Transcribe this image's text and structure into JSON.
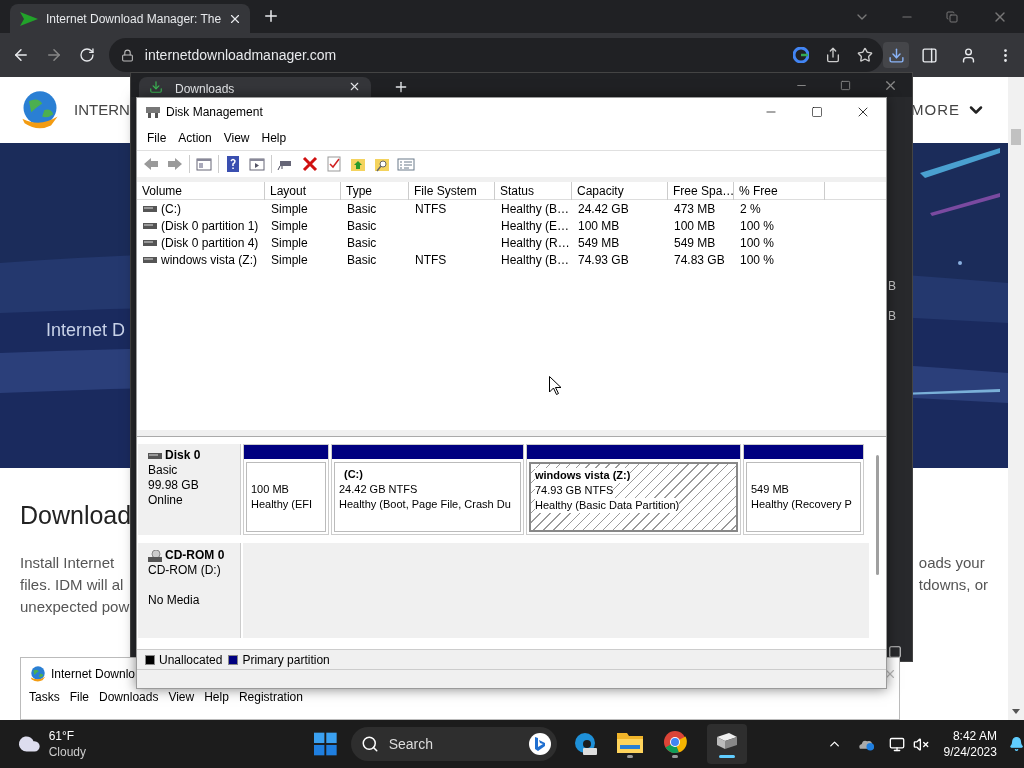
{
  "browser": {
    "tab_title": "Internet Download Manager: The",
    "url": "internetdownloadmanager.com"
  },
  "web_page": {
    "brand": "INTERN",
    "menu": "MORE",
    "hero_text": "Internet D",
    "heading": "Download",
    "paragraph_left": [
      "Install Internet",
      "files. IDM will al",
      "unexpected pow"
    ],
    "paragraph_right": [
      "oads your",
      "tdowns, or"
    ]
  },
  "downloads_window": {
    "title": "Downloads",
    "sizes": [
      "B",
      "B"
    ]
  },
  "idm_window": {
    "title": "Internet Downlo",
    "menu": [
      "Tasks",
      "File",
      "Downloads",
      "View",
      "Help",
      "Registration"
    ]
  },
  "disk_management": {
    "title": "Disk Management",
    "menu": [
      "File",
      "Action",
      "View",
      "Help"
    ],
    "table": {
      "columns": [
        "Volume",
        "Layout",
        "Type",
        "File System",
        "Status",
        "Capacity",
        "Free Spa…",
        "% Free"
      ],
      "rows": [
        [
          "(C:)",
          "Simple",
          "Basic",
          "NTFS",
          "Healthy (B…",
          "24.42 GB",
          "473 MB",
          "2 %"
        ],
        [
          "(Disk 0 partition 1)",
          "Simple",
          "Basic",
          "",
          "Healthy (E…",
          "100 MB",
          "100 MB",
          "100 %"
        ],
        [
          "(Disk 0 partition 4)",
          "Simple",
          "Basic",
          "",
          "Healthy (R…",
          "549 MB",
          "549 MB",
          "100 %"
        ],
        [
          "windows  vista (Z:)",
          "Simple",
          "Basic",
          "NTFS",
          "Healthy (B…",
          "74.93 GB",
          "74.83 GB",
          "100 %"
        ]
      ]
    },
    "disks": [
      {
        "kind": "disk",
        "name": "Disk 0",
        "type": "Basic",
        "size": "99.98 GB",
        "status": "Online",
        "partitions": [
          {
            "size": "100 MB",
            "status": "Healthy (EFI",
            "selected": false
          },
          {
            "title": "(C:)",
            "size": "24.42 GB NTFS",
            "status": "Healthy (Boot, Page File, Crash Du",
            "selected": false
          },
          {
            "title": "windows  vista  (Z:)",
            "size": "74.93 GB NTFS",
            "status": "Healthy (Basic Data Partition)",
            "selected": true
          },
          {
            "size": "549 MB",
            "status": "Healthy (Recovery P",
            "selected": false
          }
        ]
      },
      {
        "kind": "cdrom",
        "name": "CD-ROM 0",
        "type": "CD-ROM (D:)",
        "status": "No Media"
      }
    ],
    "legend": [
      {
        "label": "Unallocated",
        "color": "#000000"
      },
      {
        "label": "Primary partition",
        "color": "#000080"
      }
    ]
  },
  "taskbar": {
    "temperature": "61°F",
    "weather": "Cloudy",
    "search": "Search",
    "time": "8:42 AM",
    "date": "9/24/2023"
  }
}
